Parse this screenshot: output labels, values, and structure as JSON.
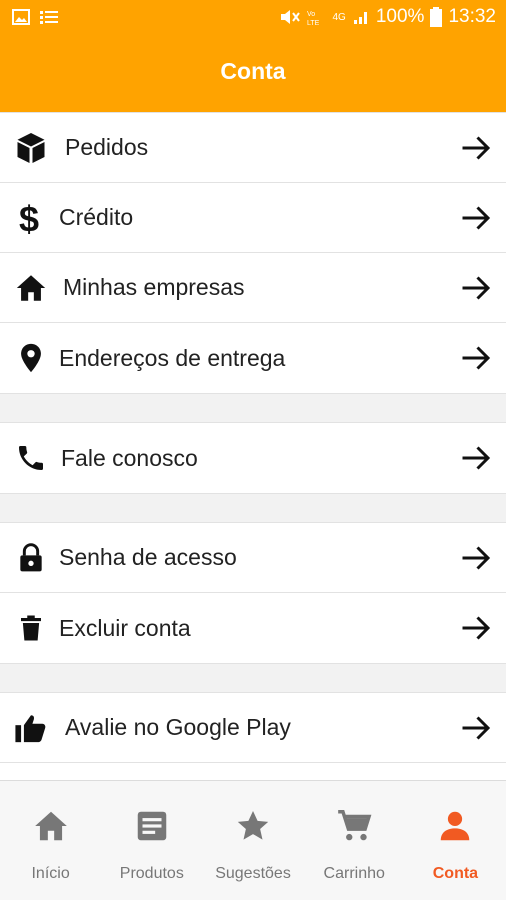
{
  "status_bar": {
    "battery": "100%",
    "time": "13:32",
    "network": "4G"
  },
  "header": {
    "title": "Conta"
  },
  "menu_groups": [
    {
      "items": [
        {
          "label": "Pedidos",
          "icon": "package-icon"
        },
        {
          "label": "Crédito",
          "icon": "dollar-icon"
        },
        {
          "label": "Minhas empresas",
          "icon": "home-icon"
        },
        {
          "label": "Endereços de entrega",
          "icon": "location-pin-icon"
        }
      ]
    },
    {
      "items": [
        {
          "label": "Fale conosco",
          "icon": "phone-icon"
        }
      ]
    },
    {
      "items": [
        {
          "label": "Senha de acesso",
          "icon": "lock-icon"
        },
        {
          "label": "Excluir conta",
          "icon": "trash-icon"
        }
      ]
    },
    {
      "items": [
        {
          "label": "Avalie no Google Play",
          "icon": "thumbs-up-icon"
        }
      ]
    }
  ],
  "bottom_nav": [
    {
      "label": "Início",
      "icon": "home-icon"
    },
    {
      "label": "Produtos",
      "icon": "list-icon"
    },
    {
      "label": "Sugestões",
      "icon": "star-icon"
    },
    {
      "label": "Carrinho",
      "icon": "cart-icon"
    },
    {
      "label": "Conta",
      "icon": "person-icon",
      "active": true
    }
  ],
  "colors": {
    "header": "#FFA300",
    "active_tab": "#F15A22"
  }
}
